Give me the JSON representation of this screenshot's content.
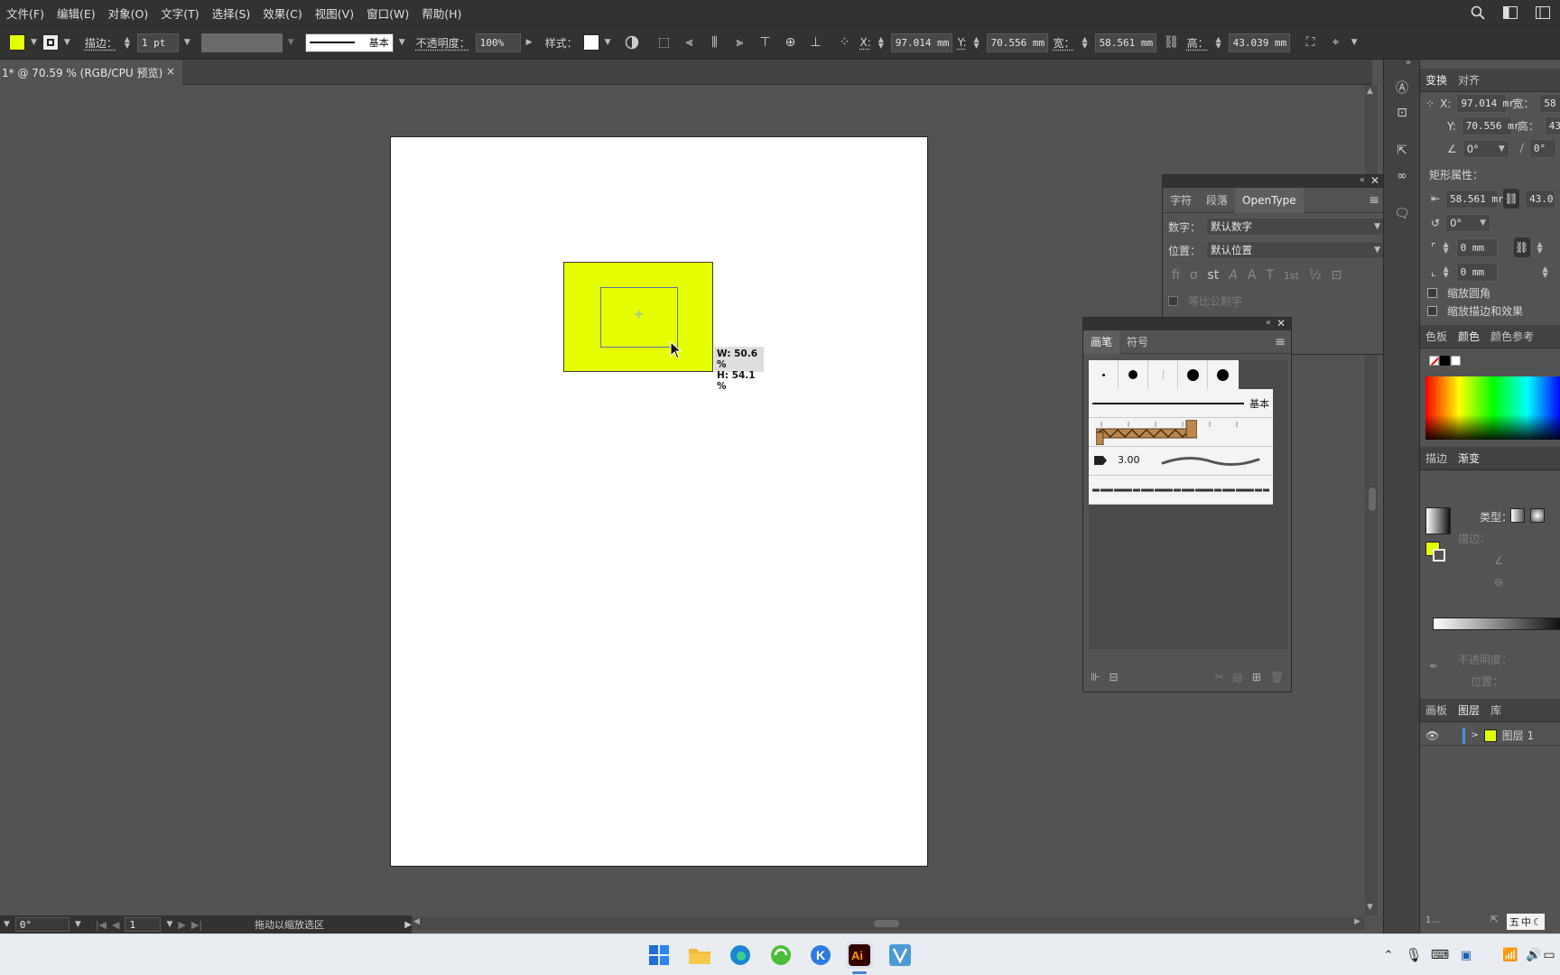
{
  "menu": [
    "文件(F)",
    "编辑(E)",
    "对象(O)",
    "文字(T)",
    "选择(S)",
    "效果(C)",
    "视图(V)",
    "窗口(W)",
    "帮助(H)"
  ],
  "colors": {
    "fill": "#e6ff00",
    "canvas": "#535353",
    "chrome": "#323232",
    "accent": "#4a90e2"
  },
  "control": {
    "stroke_label": "描边：",
    "stroke_weight": "1 pt",
    "stroke_style": "基本",
    "opacity_label": "不透明度：",
    "opacity": "100%",
    "style_label": "样式：",
    "x_label": "X:",
    "x": "97.014 mm",
    "y_label": "Y:",
    "y": "70.556 mm",
    "w_label": "宽：",
    "w": "58.561 mm",
    "h_label": "高：",
    "h": "43.039 mm"
  },
  "doc_tab": {
    "title": "1* @ 70.59 % (RGB/CPU 预览)",
    "close": "×"
  },
  "tooltip": {
    "w": "W: 50.6 %",
    "h": "H: 54.1 %"
  },
  "opentype_panel": {
    "tabs": [
      "字符",
      "段落",
      "OpenType"
    ],
    "number_label": "数字：",
    "number_value": "默认数字",
    "position_label": "位置：",
    "position_value": "默认位置",
    "glyph_icons": [
      "fi",
      "ơ",
      "st",
      "A",
      "A",
      "T",
      "1st",
      "½",
      "⊡"
    ],
    "proportional": "等比公制字"
  },
  "brushes_panel": {
    "tabs": [
      "画笔",
      "符号"
    ],
    "basic_label": "基本",
    "size_label": "3.00"
  },
  "transform_panel": {
    "tabs": [
      "变换",
      "对齐"
    ],
    "x_label": "X:",
    "x": "97.014 mr",
    "w_label": "宽：",
    "w": "58",
    "y_label": "Y:",
    "y": "70.556 mr",
    "h_label": "高：",
    "h": "43",
    "angle": "0°",
    "shear": "0°",
    "rect_props": "矩形属性：",
    "rect_w": "58.561 mr",
    "rect_h": "43.0",
    "rect_angle": "0°",
    "corner1": "0 mm",
    "corner2": "0 mm",
    "scale_corners": "缩放圆角",
    "scale_strokes": "缩放描边和效果"
  },
  "color_panel": {
    "tabs": [
      "色板",
      "颜色",
      "颜色参考"
    ]
  },
  "gradient_panel": {
    "tabs": [
      "描边",
      "渐变"
    ],
    "type_label": "类型：",
    "stroke_label": "描边：",
    "opacity_label": "不透明度：",
    "position_label": "位置："
  },
  "layers_panel": {
    "tabs": [
      "画板",
      "图层",
      "库"
    ],
    "layer_name": "图层 1",
    "footer": "1..."
  },
  "status": {
    "rotation": "0°",
    "page": "1",
    "message": "拖动以缩放选区"
  },
  "taskbar": {
    "ime_mode": "中",
    "ime_icon": "五"
  }
}
